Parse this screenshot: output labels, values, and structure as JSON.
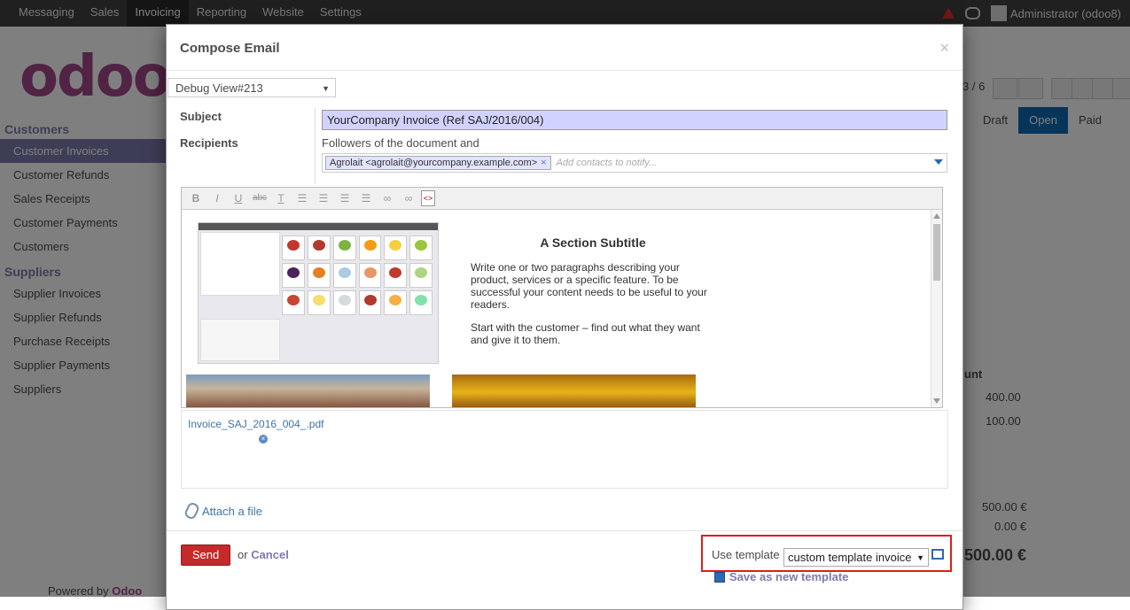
{
  "topbar": {
    "menu": [
      "Messaging",
      "Sales",
      "Invoicing",
      "Reporting",
      "Website",
      "Settings"
    ],
    "active": "Invoicing",
    "user": "Administrator (odoo8)"
  },
  "background": {
    "logo": "odoo",
    "sidebar": {
      "customers_head": "Customers",
      "customers_items": [
        "Customer Invoices",
        "Customer Refunds",
        "Sales Receipts",
        "Customer Payments",
        "Customers"
      ],
      "suppliers_head": "Suppliers",
      "suppliers_items": [
        "Supplier Invoices",
        "Supplier Refunds",
        "Purchase Receipts",
        "Supplier Payments",
        "Suppliers"
      ]
    },
    "pager": "3 / 6",
    "status": [
      "Draft",
      "Open",
      "Paid"
    ],
    "amount_header": "unt",
    "lines": [
      "400.00",
      "100.00"
    ],
    "untaxed": "500.00 €",
    "tax": "0.00 €",
    "total": "500.00 €",
    "powered_by": "Powered by",
    "powered_brand": "Odoo"
  },
  "modal": {
    "title": "Compose Email",
    "close": "×",
    "debug_view": "Debug View#213",
    "subject_label": "Subject",
    "subject_value": "YourCompany Invoice (Ref SAJ/2016/004)",
    "recipients_label": "Recipients",
    "followers_text": "Followers of the document and",
    "recipient_tag": "Agrolait <agrolait@yourcompany.example.com>",
    "recipient_tag_remove": "×",
    "recipients_placeholder": "Add contacts to notify...",
    "toolbar": {
      "bold": "B",
      "italic": "I",
      "underline": "U",
      "strike": "abc",
      "clear": "T"
    },
    "body": {
      "section_title": "A Section Subtitle",
      "paragraph1": "Write one or two paragraphs describing your product, services or a specific feature. To be successful your content needs to be useful to your readers.",
      "paragraph2": "Start with the customer – find out what they want and give it to them."
    },
    "attachment_name": "Invoice_SAJ_2016_004_.pdf",
    "attachment_remove": "×",
    "attach_file": "Attach a file",
    "send": "Send",
    "or": "or",
    "cancel": "Cancel",
    "use_template_label": "Use template",
    "template_value": "custom template invoice",
    "save_template": "Save as new template"
  },
  "colors": {
    "accent": "#7c7bad",
    "send": "#c42a2a",
    "highlight": "#d9201c",
    "subject_bg": "#d2d2ff"
  }
}
